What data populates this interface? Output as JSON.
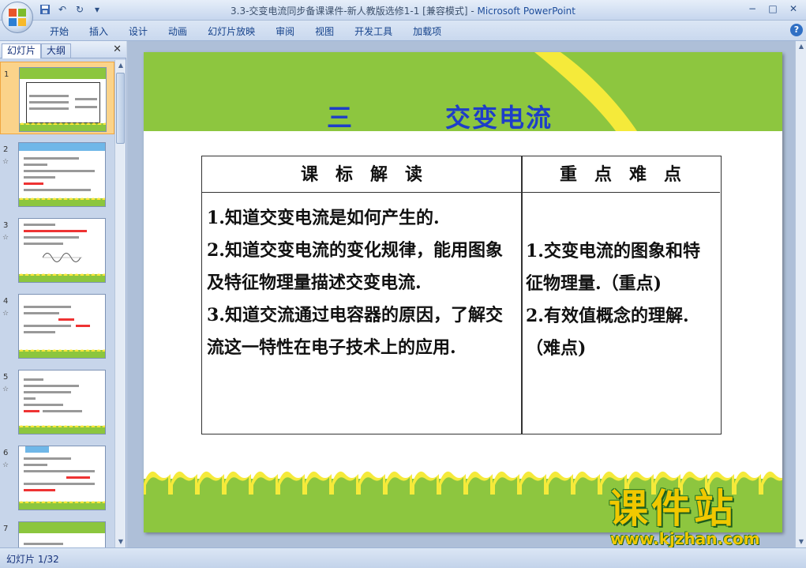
{
  "window": {
    "title": "3.3-交变电流同步备课课件-新人教版选修1-1 [兼容模式] - ",
    "app_name": "Microsoft PowerPoint",
    "controls": [
      "−",
      "□",
      "✕"
    ]
  },
  "ribbon": {
    "tabs": [
      "开始",
      "插入",
      "设计",
      "动画",
      "幻灯片放映",
      "审阅",
      "视图",
      "开发工具",
      "加载项"
    ],
    "help": "?"
  },
  "left_pane": {
    "tabs": [
      "幻灯片",
      "大纲"
    ],
    "close": "✕",
    "slide_numbers": [
      "1",
      "2",
      "3",
      "4",
      "5",
      "6",
      "7"
    ],
    "anim_marker": "☆"
  },
  "slide": {
    "title_number": "三",
    "title_text": "交变电流",
    "table": {
      "headers": [
        "课　标　解　读",
        "重　点　难　点"
      ],
      "left_items": [
        "1.知道交变电流是如何产生的.",
        "2.知道交变电流的变化规律，能用图象及特征物理量描述交变电流.",
        "3.知道交流通过电容器的原因，了解交流这一特性在电子技术上的应用."
      ],
      "right_items": [
        "1.交变电流的图象和特征物理量.（重点)",
        "2.有效值概念的理解.（难点)"
      ]
    }
  },
  "watermark": {
    "brand": "课件站",
    "url": "www.kjzhan.com"
  },
  "status_bar": {
    "slide_indicator": "幻灯片 1/32"
  },
  "colors": {
    "slide_green": "#8dc63f",
    "title_blue": "#1e3ec8",
    "swirl_yellow": "#f5ea3a",
    "selected_thumb": "#fbd38a"
  }
}
